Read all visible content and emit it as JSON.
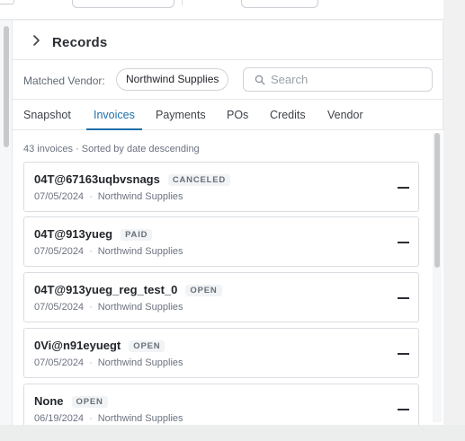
{
  "records": {
    "title": "Records",
    "matched_vendor_label": "Matched Vendor:",
    "matched_vendor": "Northwind Supplies",
    "search_placeholder": "Search"
  },
  "tabs": [
    {
      "label": "Snapshot",
      "active": false
    },
    {
      "label": "Invoices",
      "active": true
    },
    {
      "label": "Payments",
      "active": false
    },
    {
      "label": "POs",
      "active": false
    },
    {
      "label": "Credits",
      "active": false
    },
    {
      "label": "Vendor",
      "active": false
    }
  ],
  "list": {
    "meta": "43 invoices · Sorted by date descending",
    "invoices": [
      {
        "number": "04T@67163uqbvsnags",
        "status": "CANCELED",
        "date": "07/05/2024",
        "vendor": "Northwind Supplies"
      },
      {
        "number": "04T@913yueg",
        "status": "PAID",
        "date": "07/05/2024",
        "vendor": "Northwind Supplies"
      },
      {
        "number": "04T@913yueg_reg_test_0",
        "status": "OPEN",
        "date": "07/05/2024",
        "vendor": "Northwind Supplies"
      },
      {
        "number": "0Vi@n91eyuegt",
        "status": "OPEN",
        "date": "07/05/2024",
        "vendor": "Northwind Supplies"
      },
      {
        "number": "None",
        "status": "OPEN",
        "date": "06/19/2024",
        "vendor": "Northwind Supplies"
      }
    ]
  },
  "colors": {
    "accent": "#1e6fa8",
    "badge_bg": "#f1f3f5",
    "border": "#d9dde1"
  },
  "icons": {
    "expand": "chevron-right-icon",
    "search": "search-icon",
    "collapse": "minus-icon"
  }
}
